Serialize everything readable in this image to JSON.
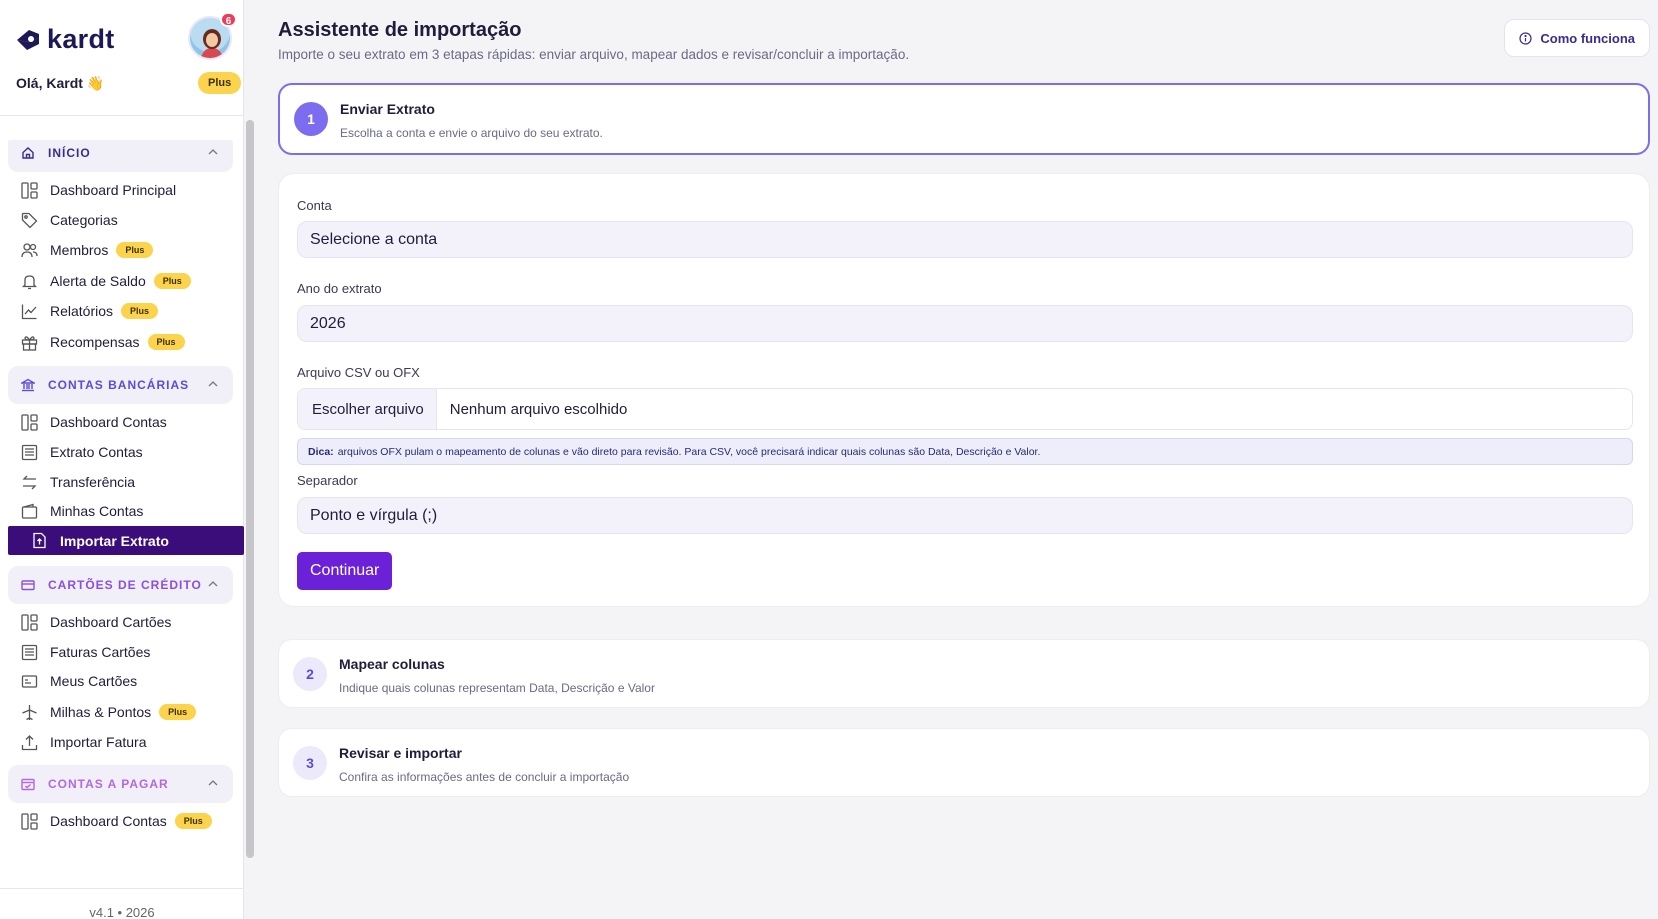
{
  "brand": {
    "name": "kardt"
  },
  "user": {
    "greeting": "Olá, Kardt 👋",
    "notifications": "6",
    "plan_badge": "Plus"
  },
  "sidebar": {
    "plus_label": "Plus",
    "sections": [
      {
        "title": "INÍCIO",
        "color": "#3b2b8f",
        "items": [
          {
            "label": "Dashboard Principal"
          },
          {
            "label": "Categorias"
          },
          {
            "label": "Membros",
            "plus": true
          },
          {
            "label": "Alerta de Saldo",
            "plus": true
          },
          {
            "label": "Relatórios",
            "plus": true
          },
          {
            "label": "Recompensas",
            "plus": true
          }
        ]
      },
      {
        "title": "CONTAS BANCÁRIAS",
        "color": "#5b4bd6",
        "items": [
          {
            "label": "Dashboard Contas"
          },
          {
            "label": "Extrato Contas"
          },
          {
            "label": "Transferência"
          },
          {
            "label": "Minhas Contas"
          },
          {
            "label": "Importar Extrato",
            "active": true
          }
        ]
      },
      {
        "title": "CARTÕES DE CRÉDITO",
        "color": "#8a4fe0",
        "items": [
          {
            "label": "Dashboard Cartões"
          },
          {
            "label": "Faturas Cartões"
          },
          {
            "label": "Meus Cartões"
          },
          {
            "label": "Milhas & Pontos",
            "plus": true
          },
          {
            "label": "Importar Fatura"
          }
        ]
      },
      {
        "title": "CONTAS A PAGAR",
        "color": "#b467e0",
        "items": [
          {
            "label": "Dashboard Contas",
            "plus": true
          }
        ]
      }
    ],
    "version": "v4.1 • 2026"
  },
  "main": {
    "title": "Assistente de importação",
    "subtitle": "Importe o seu extrato em 3 etapas rápidas: enviar arquivo, mapear dados e revisar/concluir a importação.",
    "how_it_works": "Como funciona",
    "steps": [
      {
        "number": "1",
        "title": "Enviar Extrato",
        "desc": "Escolha a conta e envie o arquivo do seu extrato."
      },
      {
        "number": "2",
        "title": "Mapear colunas",
        "desc": "Indique quais colunas representam Data, Descrição e Valor"
      },
      {
        "number": "3",
        "title": "Revisar e importar",
        "desc": "Confira as informações antes de concluir a importação"
      }
    ],
    "form": {
      "account_label": "Conta",
      "account_value": "Selecione a conta",
      "year_label": "Ano do extrato",
      "year_value": "2026",
      "file_label": "Arquivo CSV ou OFX",
      "file_button": "Escolher arquivo",
      "file_name": "Nenhum arquivo escolhido",
      "tip_bold": "Dica:",
      "tip_text": "arquivos OFX pulam o mapeamento de colunas e vão direto para revisão. Para CSV, você precisará indicar quais colunas são Data, Descrição e Valor.",
      "separator_label": "Separador",
      "separator_value": "Ponto e vírgula (;)",
      "continue": "Continuar"
    }
  },
  "colors": {
    "primary": "#6b21d8",
    "active_nav": "#3a0d7a",
    "accent": "#7c6cf0",
    "plus": "#fcd34d"
  }
}
